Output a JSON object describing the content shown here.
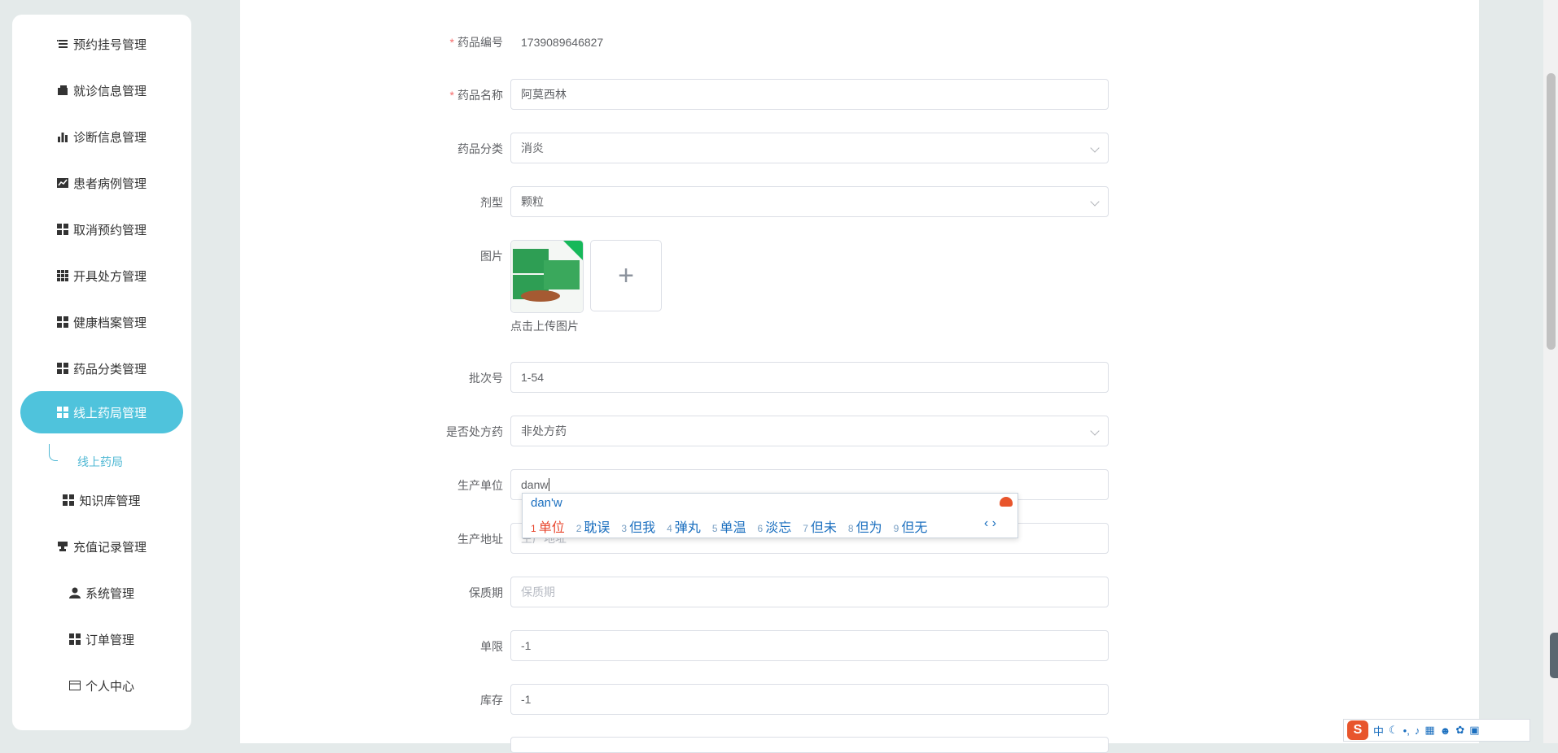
{
  "sidebar": {
    "items": [
      {
        "label": "预约挂号管理",
        "icon": "list-icon"
      },
      {
        "label": "就诊信息管理",
        "icon": "wallet-icon"
      },
      {
        "label": "诊断信息管理",
        "icon": "bar-chart-icon"
      },
      {
        "label": "患者病例管理",
        "icon": "line-chart-icon"
      },
      {
        "label": "取消预约管理",
        "icon": "grid-icon"
      },
      {
        "label": "开具处方管理",
        "icon": "apps-icon"
      },
      {
        "label": "健康档案管理",
        "icon": "grid-icon"
      },
      {
        "label": "药品分类管理",
        "icon": "grid-icon"
      },
      {
        "label": "线上药局管理",
        "icon": "grid-icon",
        "active": true
      },
      {
        "label": "知识库管理",
        "icon": "grid-icon"
      },
      {
        "label": "充值记录管理",
        "icon": "stamp-icon"
      },
      {
        "label": "系统管理",
        "icon": "user-icon"
      },
      {
        "label": "订单管理",
        "icon": "grid-icon"
      },
      {
        "label": "个人中心",
        "icon": "card-icon"
      }
    ],
    "submenu_label": "线上药局",
    "active_color": "#4fc3dc"
  },
  "form": {
    "code": {
      "label": "药品编号",
      "value": "1739089646827",
      "required": true
    },
    "name": {
      "label": "药品名称",
      "value": "阿莫西林",
      "required": true
    },
    "category": {
      "label": "药品分类",
      "value": "消炎"
    },
    "dosage": {
      "label": "剂型",
      "value": "颗粒"
    },
    "image": {
      "label": "图片",
      "upload_tip": "点击上传图片",
      "plus": "+"
    },
    "batch": {
      "label": "批次号",
      "value": "1-54"
    },
    "prescription": {
      "label": "是否处方药",
      "value": "非处方药"
    },
    "producer": {
      "label": "生产单位",
      "value": "danw"
    },
    "address": {
      "label": "生产地址",
      "placeholder": "生产地址"
    },
    "shelf_life": {
      "label": "保质期",
      "placeholder": "保质期"
    },
    "limit": {
      "label": "单限",
      "value": "-1"
    },
    "stock": {
      "label": "库存",
      "value": "-1"
    }
  },
  "ime_popup": {
    "pinyin": "dan'w",
    "candidates": [
      {
        "n": "1",
        "text": "单位"
      },
      {
        "n": "2",
        "text": "耽误"
      },
      {
        "n": "3",
        "text": "但我"
      },
      {
        "n": "4",
        "text": "弹丸"
      },
      {
        "n": "5",
        "text": "单温"
      },
      {
        "n": "6",
        "text": "淡忘"
      },
      {
        "n": "7",
        "text": "但未"
      },
      {
        "n": "8",
        "text": "但为"
      },
      {
        "n": "9",
        "text": "但无"
      }
    ],
    "pager": "‹ ›"
  },
  "ime_toolbar": {
    "logo": "S",
    "lang": "中"
  }
}
